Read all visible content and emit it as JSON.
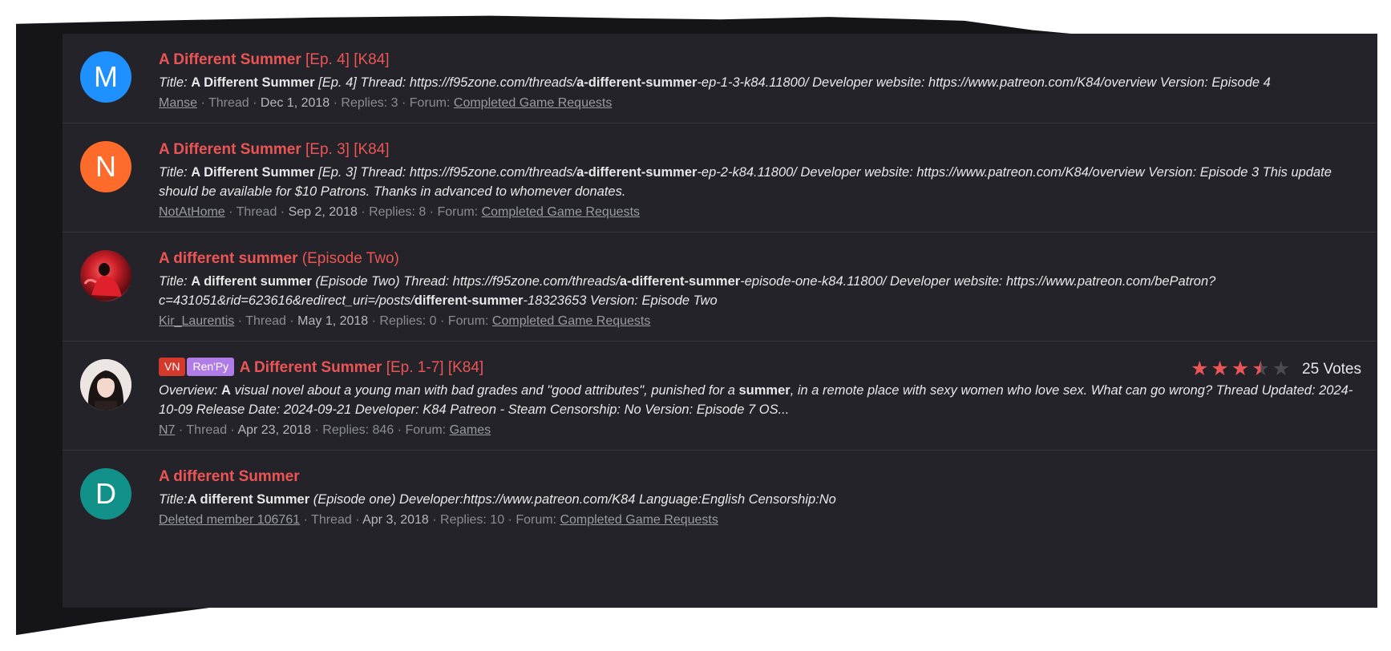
{
  "results": [
    {
      "avatar_letter": "M",
      "avatar_color": "#1e90ff",
      "title": "A Different Summer",
      "title_suffix": "[Ep. 4] [K84]",
      "snippet": {
        "p1": "Title: ",
        "b1": "A Different Summer",
        "p2": " [Ep. 4] Thread: https://f95zone.com/threads/",
        "b2": "a-different-summer",
        "p3": "-ep-1-3-k84.11800/ Developer website: https://www.patreon.com/K84/overview Version: Episode 4"
      },
      "author": "Manse",
      "type": "Thread",
      "date": "Dec 1, 2018",
      "replies": "Replies: 3",
      "forum_label": "Forum:",
      "forum": "Completed Game Requests"
    },
    {
      "avatar_letter": "N",
      "avatar_color": "#ff6b2b",
      "title": "A Different Summer",
      "title_suffix": "[Ep. 3] [K84]",
      "snippet": {
        "p1": "Title: ",
        "b1": "A Different Summer",
        "p2": " [Ep. 3] Thread: https://f95zone.com/threads/",
        "b2": "a-different-summer",
        "p3": "-ep-2-k84.11800/ Developer website: https://www.patreon.com/K84/overview Version: Episode 3 This update should be available for $10 Patrons. Thanks in advanced to whomever donates."
      },
      "author": "NotAtHome",
      "type": "Thread",
      "date": "Sep 2, 2018",
      "replies": "Replies: 8",
      "forum_label": "Forum:",
      "forum": "Completed Game Requests"
    },
    {
      "avatar_letter": "",
      "avatar_color": "#c81e28",
      "title": "A different summer",
      "title_suffix": "(Episode Two)",
      "snippet": {
        "p1": "Title: ",
        "b1": "A different summer",
        "p2": " (Episode Two) Thread: https://f95zone.com/threads/",
        "b2": "a-different-summer",
        "p3": "-episode-one-k84.11800/ Developer website: https://www.patreon.com/bePatron?c=431051&rid=623616&redirect_uri=/posts/",
        "b3": "different-summer",
        "p4": "-18323653 Version: Episode Two"
      },
      "author": "Kir_Laurentis",
      "type": "Thread",
      "date": "May 1, 2018",
      "replies": "Replies: 0",
      "forum_label": "Forum:",
      "forum": "Completed Game Requests"
    },
    {
      "avatar_letter": "",
      "avatar_color": "#d8d2d0",
      "badges": [
        {
          "label": "VN",
          "color": "#d33a2c"
        },
        {
          "label": "Ren'Py",
          "color": "#b07ce8"
        }
      ],
      "title": "A Different Summer",
      "title_suffix": "[Ep. 1-7] [K84]",
      "rating": 3.5,
      "votes": "25 Votes",
      "snippet": {
        "p1": "Overview: ",
        "b1": "A",
        "p2": " visual novel about a young man with bad grades and \"good attributes\", punished for a ",
        "b2": "summer",
        "p3": ", in a remote place with sexy women who love sex. What can go wrong? Thread Updated: 2024-10-09 Release Date: 2024-09-21 Developer: K84 Patreon - Steam Censorship: No Version: Episode 7 OS..."
      },
      "author": "N7",
      "type": "Thread",
      "date": "Apr 23, 2018",
      "replies": "Replies: 846",
      "forum_label": "Forum:",
      "forum": "Games"
    },
    {
      "avatar_letter": "D",
      "avatar_color": "#11918a",
      "title": "A different Summer",
      "title_suffix": "",
      "snippet": {
        "p1": "Title:",
        "b1": "A different Summer",
        "p2": " (Episode one) Developer:https://www.patreon.com/K84 Language:English Censorship:No"
      },
      "author": "Deleted member 106761",
      "type": "Thread",
      "date": "Apr 3, 2018",
      "replies": "Replies: 10",
      "forum_label": "Forum:",
      "forum": "Completed Game Requests"
    }
  ],
  "icons": {
    "star": "star-icon"
  },
  "colors": {
    "accent": "#ec5555",
    "panel_bg": "#232329",
    "page_bg": "#141419"
  }
}
